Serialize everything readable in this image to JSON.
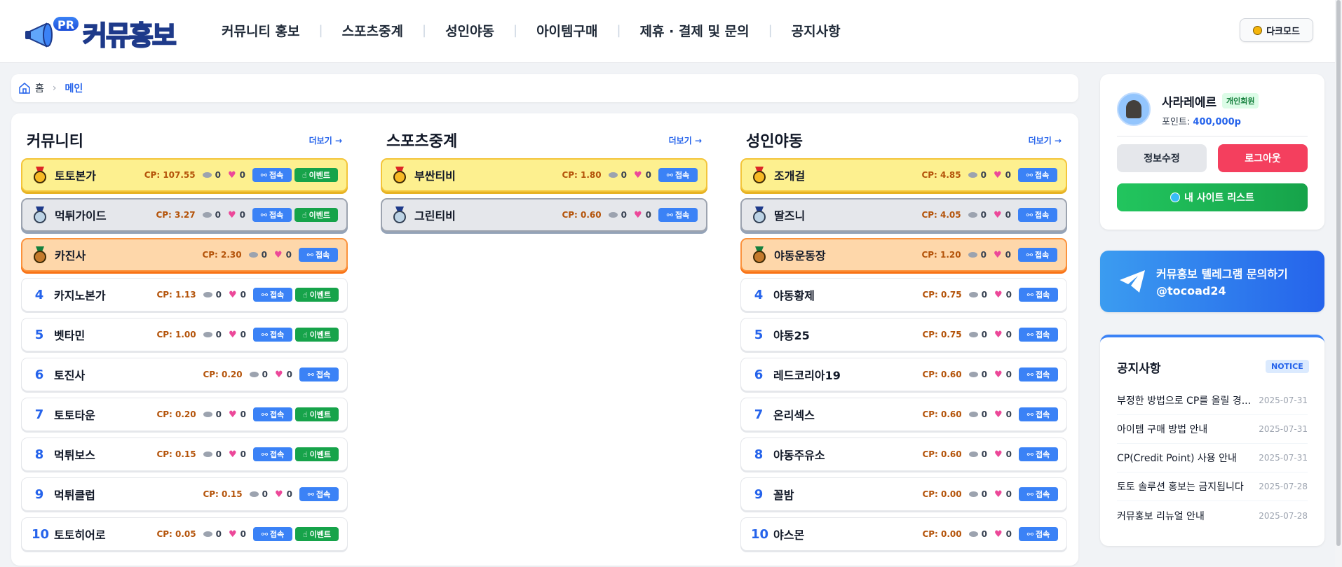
{
  "header": {
    "logo_badge": "PR",
    "logo_text": "커뮤홍보",
    "nav": [
      "커뮤니티 홍보",
      "스포츠중계",
      "성인야동",
      "아이템구매",
      "제휴 · 결제 및 문의",
      "공지사항"
    ],
    "dark_mode_label": "다크모드"
  },
  "breadcrumb": {
    "home": "홈",
    "current": "메인"
  },
  "columns": [
    {
      "title": "커뮤니티",
      "more": "더보기 →",
      "rows": [
        {
          "rank": "1",
          "name": "토토본가",
          "cp": "CP: 107.55",
          "views": "0",
          "likes": "0",
          "go": "접속",
          "event": "이벤트"
        },
        {
          "rank": "2",
          "name": "먹튀가이드",
          "cp": "CP: 3.27",
          "views": "0",
          "likes": "0",
          "go": "접속",
          "event": "이벤트"
        },
        {
          "rank": "3",
          "name": "카진사",
          "cp": "CP: 2.30",
          "views": "0",
          "likes": "0",
          "go": "접속"
        },
        {
          "rank": "4",
          "name": "카지노본가",
          "cp": "CP: 1.13",
          "views": "0",
          "likes": "0",
          "go": "접속",
          "event": "이벤트"
        },
        {
          "rank": "5",
          "name": "벳타민",
          "cp": "CP: 1.00",
          "views": "0",
          "likes": "0",
          "go": "접속",
          "event": "이벤트"
        },
        {
          "rank": "6",
          "name": "토진사",
          "cp": "CP: 0.20",
          "views": "0",
          "likes": "0",
          "go": "접속"
        },
        {
          "rank": "7",
          "name": "토토타운",
          "cp": "CP: 0.20",
          "views": "0",
          "likes": "0",
          "go": "접속",
          "event": "이벤트"
        },
        {
          "rank": "8",
          "name": "먹튀보스",
          "cp": "CP: 0.15",
          "views": "0",
          "likes": "0",
          "go": "접속",
          "event": "이벤트"
        },
        {
          "rank": "9",
          "name": "먹튀클럽",
          "cp": "CP: 0.15",
          "views": "0",
          "likes": "0",
          "go": "접속"
        },
        {
          "rank": "10",
          "name": "토토히어로",
          "cp": "CP: 0.05",
          "views": "0",
          "likes": "0",
          "go": "접속",
          "event": "이벤트"
        }
      ]
    },
    {
      "title": "스포츠중계",
      "more": "더보기 →",
      "rows": [
        {
          "rank": "1",
          "name": "부싼티비",
          "cp": "CP: 1.80",
          "views": "0",
          "likes": "0",
          "go": "접속"
        },
        {
          "rank": "2",
          "name": "그린티비",
          "cp": "CP: 0.60",
          "views": "0",
          "likes": "0",
          "go": "접속"
        }
      ]
    },
    {
      "title": "성인야동",
      "more": "더보기 →",
      "rows": [
        {
          "rank": "1",
          "name": "조개걸",
          "cp": "CP: 4.85",
          "views": "0",
          "likes": "0",
          "go": "접속"
        },
        {
          "rank": "2",
          "name": "딸즈니",
          "cp": "CP: 4.05",
          "views": "0",
          "likes": "0",
          "go": "접속"
        },
        {
          "rank": "3",
          "name": "야동운동장",
          "cp": "CP: 1.20",
          "views": "0",
          "likes": "0",
          "go": "접속"
        },
        {
          "rank": "4",
          "name": "야동황제",
          "cp": "CP: 0.75",
          "views": "0",
          "likes": "0",
          "go": "접속"
        },
        {
          "rank": "5",
          "name": "야동25",
          "cp": "CP: 0.75",
          "views": "0",
          "likes": "0",
          "go": "접속"
        },
        {
          "rank": "6",
          "name": "레드코리아19",
          "cp": "CP: 0.60",
          "views": "0",
          "likes": "0",
          "go": "접속"
        },
        {
          "rank": "7",
          "name": "온리섹스",
          "cp": "CP: 0.60",
          "views": "0",
          "likes": "0",
          "go": "접속"
        },
        {
          "rank": "8",
          "name": "야동주유소",
          "cp": "CP: 0.60",
          "views": "0",
          "likes": "0",
          "go": "접속"
        },
        {
          "rank": "9",
          "name": "꼴밤",
          "cp": "CP: 0.00",
          "views": "0",
          "likes": "0",
          "go": "접속"
        },
        {
          "rank": "10",
          "name": "야스몬",
          "cp": "CP: 0.00",
          "views": "0",
          "likes": "0",
          "go": "접속"
        }
      ]
    }
  ],
  "profile": {
    "username": "사라레에르",
    "badge": "개인회원",
    "points_label": "포인트:",
    "points_value": "400,000p",
    "edit_label": "정보수정",
    "logout_label": "로그아웃",
    "sites_label": "내 사이트 리스트"
  },
  "telegram": {
    "line1": "커뮤홍보 텔레그램 문의하기",
    "line2": "@tocoad24"
  },
  "notice": {
    "title": "공지사항",
    "badge": "NOTICE",
    "items": [
      {
        "text": "부정한 방법으로 CP를 올릴 경...",
        "date": "2025-07-31"
      },
      {
        "text": "아이템 구매 방법 안내",
        "date": "2025-07-31"
      },
      {
        "text": "CP(Credit Point) 사용 안내",
        "date": "2025-07-31"
      },
      {
        "text": "토토 솔루션 홍보는 금지됩니다",
        "date": "2025-07-28"
      },
      {
        "text": "커뮤홍보 리뉴얼 안내",
        "date": "2025-07-28"
      }
    ]
  },
  "colors": {
    "accent": "#2563eb",
    "gold": "#fdf08f",
    "silver": "#e5e7eb",
    "bronze": "#fed7aa",
    "event_green": "#16a34a",
    "logout_red": "#f43f5e"
  }
}
